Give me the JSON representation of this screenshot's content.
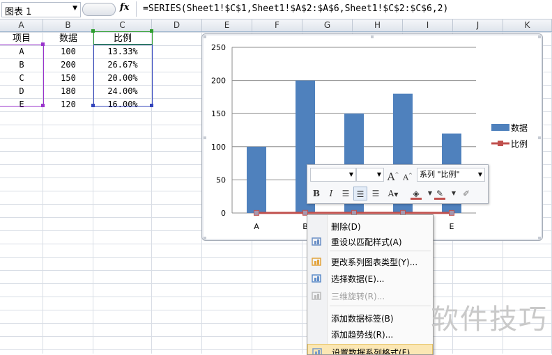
{
  "formula_bar": {
    "name_box": "图表 1",
    "fx": "fx",
    "formula": "=SERIES(Sheet1!$C$1,Sheet1!$A$2:$A$6,Sheet1!$C$2:$C$6,2)"
  },
  "columns": [
    "A",
    "B",
    "C",
    "D",
    "E",
    "F",
    "G",
    "H",
    "I",
    "J",
    "K"
  ],
  "table": {
    "headers": [
      "项目",
      "数据",
      "比例"
    ],
    "rows": [
      [
        "A",
        "100",
        "13.33%"
      ],
      [
        "B",
        "200",
        "26.67%"
      ],
      [
        "C",
        "150",
        "20.00%"
      ],
      [
        "D",
        "180",
        "24.00%"
      ],
      [
        "E",
        "120",
        "16.00%"
      ]
    ]
  },
  "chart_data": {
    "type": "bar",
    "categories": [
      "A",
      "B",
      "C",
      "D",
      "E"
    ],
    "series": [
      {
        "name": "数据",
        "type": "bar",
        "values": [
          100,
          200,
          150,
          180,
          120
        ],
        "color": "#4f81bd"
      },
      {
        "name": "比例",
        "type": "line",
        "values": [
          0.1333,
          0.2667,
          0.2,
          0.24,
          0.16
        ],
        "color": "#c0504d"
      }
    ],
    "yticks": [
      "0",
      "50",
      "100",
      "150",
      "200",
      "250"
    ],
    "ylim": [
      0,
      250
    ],
    "grid": true,
    "legend": "right"
  },
  "mini_toolbar": {
    "font_box": "",
    "size_box": "",
    "grow_font": "A",
    "shrink_font": "A",
    "series_selector": "系列 \"比例\"",
    "bold": "B",
    "italic": "I",
    "font_color": "A"
  },
  "context_menu": {
    "items": [
      {
        "label": "删除(D)",
        "enabled": true,
        "icon": ""
      },
      {
        "label": "重设以匹配样式(A)",
        "enabled": true,
        "icon": "reset-style-icon"
      },
      {
        "label": "更改系列图表类型(Y)...",
        "enabled": true,
        "icon": "chart-type-icon"
      },
      {
        "label": "选择数据(E)...",
        "enabled": true,
        "icon": "select-data-icon"
      },
      {
        "label": "三维旋转(R)...",
        "enabled": false,
        "icon": "3d-rotate-icon"
      },
      {
        "label": "添加数据标签(B)",
        "enabled": true,
        "icon": ""
      },
      {
        "label": "添加趋势线(R)...",
        "enabled": true,
        "icon": ""
      },
      {
        "label": "设置数据系列格式(F)...",
        "enabled": true,
        "icon": "format-series-icon"
      }
    ]
  },
  "watermark": "软件技巧"
}
